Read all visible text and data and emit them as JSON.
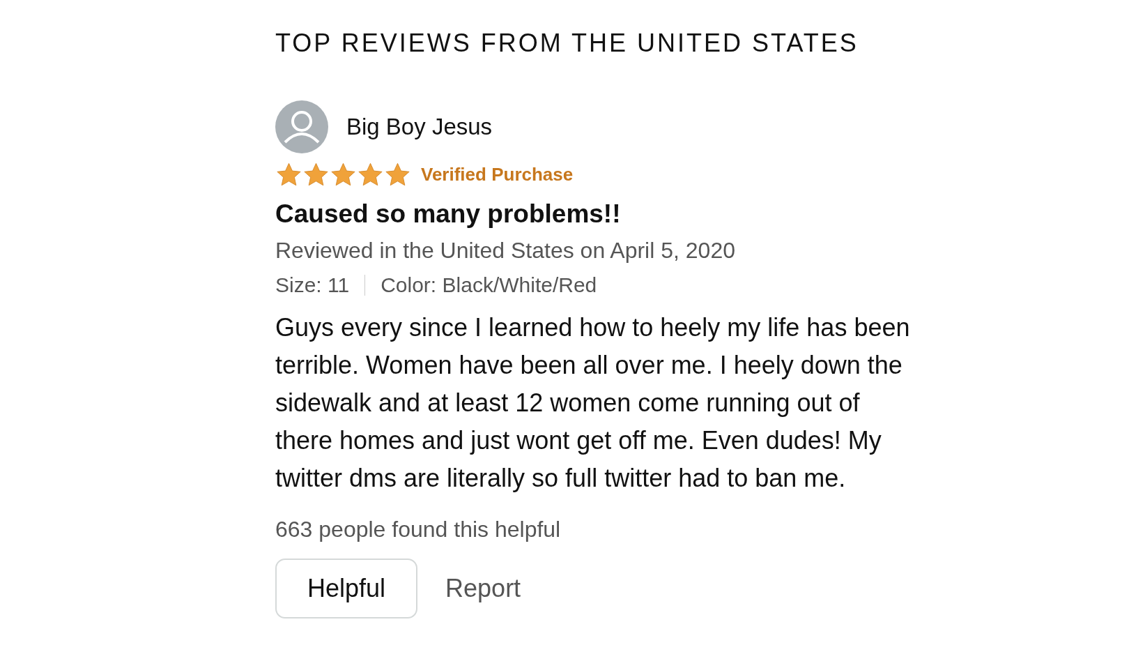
{
  "section_title": "TOP REVIEWS FROM THE UNITED STATES",
  "review": {
    "author": "Big Boy Jesus",
    "stars": 5,
    "badge": "Verified Purchase",
    "title": "Caused so many problems!!",
    "meta": "Reviewed in the United States on April 5, 2020",
    "variants": [
      "Size: 11",
      "Color: Black/White/Red"
    ],
    "body": "Guys every since I learned how to heely my life has been terrible. Women have been all over me. I heely down the sidewalk and at least 12 women come running out of there homes and just wont get off me. Even dudes! My twitter dms are literally so full twitter had to ban me.",
    "helpful_count": "663 people found this helpful",
    "actions": [
      {
        "label": "Helpful",
        "kind": "button"
      },
      {
        "label": "Report",
        "kind": "link"
      }
    ]
  }
}
